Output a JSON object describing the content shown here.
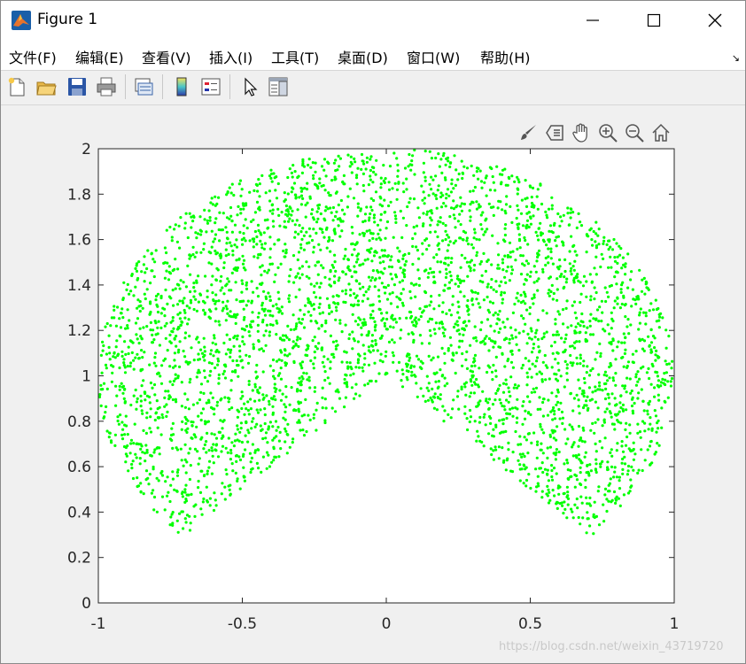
{
  "window": {
    "title": "Figure 1",
    "controls": [
      "minimize",
      "maximize",
      "close"
    ]
  },
  "menubar": {
    "items": [
      {
        "label": "文件(F)"
      },
      {
        "label": "编辑(E)"
      },
      {
        "label": "查看(V)"
      },
      {
        "label": "插入(I)"
      },
      {
        "label": "工具(T)"
      },
      {
        "label": "桌面(D)"
      },
      {
        "label": "窗口(W)"
      },
      {
        "label": "帮助(H)"
      }
    ],
    "corner_glyph": "↘"
  },
  "toolbar": {
    "buttons": [
      "new-figure-icon",
      "open-file-icon",
      "save-icon",
      "print-icon",
      "link-plot-icon",
      "colorbar-icon",
      "legend-icon",
      "edit-plot-icon",
      "property-inspector-icon"
    ]
  },
  "axes_toolbar": {
    "buttons": [
      "brush-icon",
      "data-tips-icon",
      "pan-hand-icon",
      "zoom-in-icon",
      "zoom-out-icon",
      "home-icon"
    ]
  },
  "watermark": "https://blog.csdn.net/weixin_43719720",
  "chart_data": {
    "type": "scatter",
    "title": "",
    "xlabel": "",
    "ylabel": "",
    "xlim": [
      -1,
      1
    ],
    "ylim": [
      0,
      2
    ],
    "xticks": [
      "-1",
      "-0.5",
      "0",
      "0.5",
      "1"
    ],
    "yticks": [
      "0",
      "0.2",
      "0.4",
      "0.6",
      "0.8",
      "1",
      "1.2",
      "1.4",
      "1.6",
      "1.8",
      "2"
    ],
    "grid": false,
    "marker_color": "#00ff00",
    "point_count": 4000,
    "region": "sector: radius r in [0,1] centered at (0,1), angle in [-45°, 225°]; x = r·cos(θ), y = 1 + r·sin(θ)"
  }
}
